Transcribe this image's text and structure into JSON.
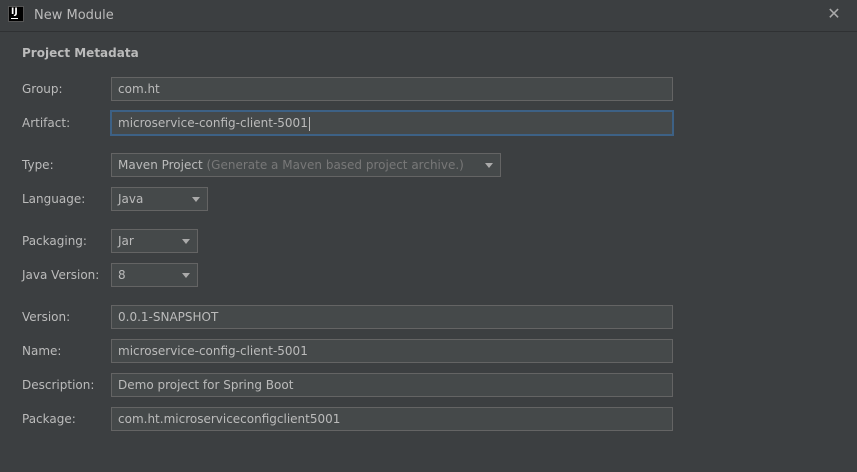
{
  "window": {
    "title": "New Module",
    "app_icon_text": "IJ",
    "close_icon": "close-icon"
  },
  "section": {
    "title": "Project Metadata"
  },
  "form": {
    "group": {
      "label": "Group:",
      "value": "com.ht"
    },
    "artifact": {
      "label": "Artifact:",
      "value": "microservice-config-client-5001"
    },
    "type": {
      "label": "Type:",
      "value": "Maven Project",
      "hint": "(Generate a Maven based project archive.)"
    },
    "language": {
      "label": "Language:",
      "value": "Java"
    },
    "packaging": {
      "label": "Packaging:",
      "value": "Jar"
    },
    "java_version": {
      "label": "Java Version:",
      "value": "8"
    },
    "version": {
      "label": "Version:",
      "value": "0.0.1-SNAPSHOT"
    },
    "name": {
      "label": "Name:",
      "value": "microservice-config-client-5001"
    },
    "description": {
      "label": "Description:",
      "value": "Demo project for Spring Boot"
    },
    "package": {
      "label": "Package:",
      "value": "com.ht.microserviceconfigclient5001"
    }
  },
  "colors": {
    "background": "#3c3f41",
    "field_bg": "#45494a",
    "focus": "#3d6185",
    "text": "#bbbbbb"
  }
}
